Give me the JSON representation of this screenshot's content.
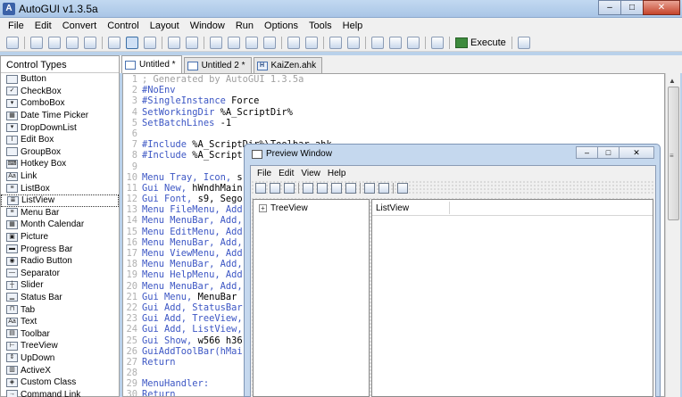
{
  "window": {
    "title": "AutoGUI v1.3.5a",
    "minimize": "–",
    "maximize": "□",
    "close": "✕"
  },
  "menu": [
    "File",
    "Edit",
    "Convert",
    "Control",
    "Layout",
    "Window",
    "Run",
    "Options",
    "Tools",
    "Help"
  ],
  "toolbar": {
    "execute_label": "Execute"
  },
  "left_panel": {
    "header": "Control Types",
    "items": [
      {
        "label": "Button",
        "icon": "button-icon",
        "glyph": ""
      },
      {
        "label": "CheckBox",
        "icon": "checkbox-icon",
        "glyph": "✓"
      },
      {
        "label": "ComboBox",
        "icon": "combobox-icon",
        "glyph": "▾"
      },
      {
        "label": "Date Time Picker",
        "icon": "datetime-icon",
        "glyph": "▦"
      },
      {
        "label": "DropDownList",
        "icon": "dropdown-icon",
        "glyph": "▾"
      },
      {
        "label": "Edit Box",
        "icon": "editbox-icon",
        "glyph": "I"
      },
      {
        "label": "GroupBox",
        "icon": "groupbox-icon",
        "glyph": ""
      },
      {
        "label": "Hotkey Box",
        "icon": "hotkey-icon",
        "glyph": "⌨"
      },
      {
        "label": "Link",
        "icon": "link-icon",
        "glyph": "Aa"
      },
      {
        "label": "ListBox",
        "icon": "listbox-icon",
        "glyph": "≡"
      },
      {
        "label": "ListView",
        "icon": "listview-icon",
        "glyph": "≣"
      },
      {
        "label": "Menu Bar",
        "icon": "menubar-icon",
        "glyph": "≡"
      },
      {
        "label": "Month Calendar",
        "icon": "calendar-icon",
        "glyph": "▦"
      },
      {
        "label": "Picture",
        "icon": "picture-icon",
        "glyph": "▣"
      },
      {
        "label": "Progress Bar",
        "icon": "progressbar-icon",
        "glyph": "▬"
      },
      {
        "label": "Radio Button",
        "icon": "radio-icon",
        "glyph": "◉"
      },
      {
        "label": "Separator",
        "icon": "separator-icon",
        "glyph": "—"
      },
      {
        "label": "Slider",
        "icon": "slider-icon",
        "glyph": "┼"
      },
      {
        "label": "Status Bar",
        "icon": "statusbar-icon",
        "glyph": "▁"
      },
      {
        "label": "Tab",
        "icon": "tab-icon",
        "glyph": "⊓"
      },
      {
        "label": "Text",
        "icon": "text-icon",
        "glyph": "Aa"
      },
      {
        "label": "Toolbar",
        "icon": "toolbar-icon",
        "glyph": "▤"
      },
      {
        "label": "TreeView",
        "icon": "treeview-icon",
        "glyph": "⊢"
      },
      {
        "label": "UpDown",
        "icon": "updown-icon",
        "glyph": "⇕"
      },
      {
        "label": "ActiveX",
        "icon": "activex-icon",
        "glyph": "▥"
      },
      {
        "label": "Custom Class",
        "icon": "customclass-icon",
        "glyph": "◈"
      },
      {
        "label": "Command Link",
        "icon": "commandlink-icon",
        "glyph": "→"
      }
    ],
    "selected_index": 10
  },
  "tabs": [
    {
      "label": "Untitled *",
      "active": true
    },
    {
      "label": "Untitled 2 *",
      "active": false
    },
    {
      "label": "KaiZen.ahk",
      "active": false,
      "glyph": "H"
    }
  ],
  "code_lines": [
    {
      "n": "1",
      "parts": [
        [
          "comment",
          "; Generated by AutoGUI 1.3.5a"
        ]
      ]
    },
    {
      "n": "2",
      "parts": [
        [
          "dir",
          "#NoEnv"
        ]
      ]
    },
    {
      "n": "3",
      "parts": [
        [
          "dir",
          "#SingleInstance"
        ],
        [
          "txt",
          " Force"
        ]
      ]
    },
    {
      "n": "4",
      "parts": [
        [
          "cmd",
          "SetWorkingDir"
        ],
        [
          "txt",
          " %A_ScriptDir%"
        ]
      ]
    },
    {
      "n": "5",
      "parts": [
        [
          "cmd",
          "SetBatchLines"
        ],
        [
          "txt",
          " -1"
        ]
      ]
    },
    {
      "n": "6",
      "parts": []
    },
    {
      "n": "7",
      "parts": [
        [
          "dir",
          "#Include"
        ],
        [
          "txt",
          " %A_ScriptDir%\\Toolbar.ahk"
        ]
      ]
    },
    {
      "n": "8",
      "parts": [
        [
          "dir",
          "#Include"
        ],
        [
          "txt",
          " %A_Script"
        ]
      ]
    },
    {
      "n": "9",
      "parts": []
    },
    {
      "n": "10",
      "parts": [
        [
          "cmd",
          "Menu Tray, Icon,"
        ],
        [
          "txt",
          " s"
        ]
      ]
    },
    {
      "n": "11",
      "parts": [
        [
          "cmd",
          "Gui New,"
        ],
        [
          "txt",
          " hWndhMain"
        ]
      ]
    },
    {
      "n": "12",
      "parts": [
        [
          "cmd",
          "Gui Font,"
        ],
        [
          "txt",
          " s9, Sego"
        ]
      ]
    },
    {
      "n": "13",
      "parts": [
        [
          "cmd",
          "Menu FileMenu, Add"
        ]
      ]
    },
    {
      "n": "14",
      "parts": [
        [
          "cmd",
          "Menu MenuBar, Add,"
        ]
      ]
    },
    {
      "n": "15",
      "parts": [
        [
          "cmd",
          "Menu EditMenu, Add"
        ]
      ]
    },
    {
      "n": "16",
      "parts": [
        [
          "cmd",
          "Menu MenuBar, Add,"
        ]
      ]
    },
    {
      "n": "17",
      "parts": [
        [
          "cmd",
          "Menu ViewMenu, Add"
        ]
      ]
    },
    {
      "n": "18",
      "parts": [
        [
          "cmd",
          "Menu MenuBar, Add,"
        ]
      ]
    },
    {
      "n": "19",
      "parts": [
        [
          "cmd",
          "Menu HelpMenu, Add"
        ]
      ]
    },
    {
      "n": "20",
      "parts": [
        [
          "cmd",
          "Menu MenuBar, Add,"
        ]
      ]
    },
    {
      "n": "21",
      "parts": [
        [
          "cmd",
          "Gui Menu,"
        ],
        [
          "txt",
          " MenuBar"
        ]
      ]
    },
    {
      "n": "22",
      "parts": [
        [
          "cmd",
          "Gui Add, StatusBar"
        ]
      ]
    },
    {
      "n": "23",
      "parts": [
        [
          "cmd",
          "Gui Add, TreeView,"
        ]
      ]
    },
    {
      "n": "24",
      "parts": [
        [
          "cmd",
          "Gui Add, ListView,"
        ]
      ]
    },
    {
      "n": "25",
      "parts": [
        [
          "cmd",
          "Gui Show,"
        ],
        [
          "txt",
          " w566 h36"
        ]
      ]
    },
    {
      "n": "26",
      "parts": [
        [
          "cmd",
          "GuiAddToolBar(hMai"
        ]
      ]
    },
    {
      "n": "27",
      "parts": [
        [
          "cmd",
          "Return"
        ]
      ]
    },
    {
      "n": "28",
      "parts": []
    },
    {
      "n": "29",
      "parts": [
        [
          "cmd",
          "MenuHandler:"
        ]
      ]
    },
    {
      "n": "30",
      "parts": [
        [
          "cmd",
          "Return"
        ]
      ]
    }
  ],
  "preview": {
    "title": "Preview Window",
    "menu": [
      "File",
      "Edit",
      "View",
      "Help"
    ],
    "treeview_node": "TreeView",
    "listview_column": "ListView"
  },
  "colors": {
    "comment": "#a0a0a0",
    "keyword": "#3c56c4",
    "selection": "#3a6ea5"
  }
}
